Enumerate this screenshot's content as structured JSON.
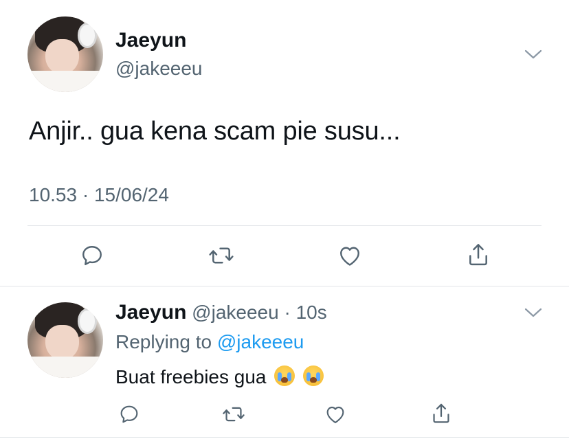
{
  "main_tweet": {
    "display_name": "Jaeyun",
    "handle": "@jakeeeu",
    "text": "Anjir.. gua kena scam pie susu...",
    "meta": "10.53 · 15/06/24",
    "actions": [
      "reply-icon",
      "retweet-icon",
      "like-icon",
      "share-icon"
    ]
  },
  "reply_tweet": {
    "display_name": "Jaeyun",
    "handle": "@jakeeeu",
    "time_sep": "·",
    "time": "10s",
    "replying_label": "Replying to",
    "replying_to": "@jakeeeu",
    "text": "Buat freebies gua",
    "emojis": [
      "loudly-crying-face",
      "loudly-crying-face"
    ],
    "actions": [
      "reply-icon",
      "retweet-icon",
      "like-icon",
      "share-icon"
    ]
  },
  "colors": {
    "text": "#0f1419",
    "secondary": "#536471",
    "link": "#1d9bf0",
    "divider": "#e1e4e8"
  }
}
